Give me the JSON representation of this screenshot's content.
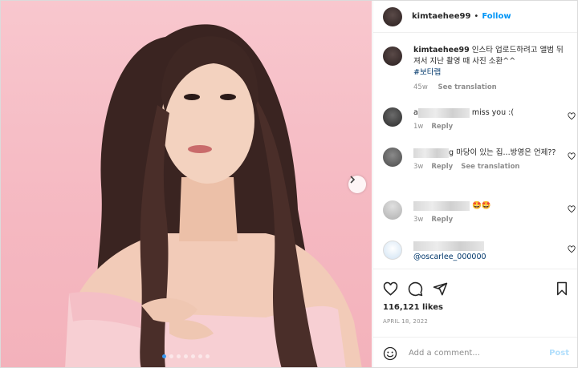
{
  "post": {
    "username": "kimtaehee99",
    "separator": "•",
    "follow_label": "Follow"
  },
  "caption": {
    "username": "kimtaehee99",
    "text": "인스타 업로드하려고 앨범 뒤져서 지난 촬영 때 사진 소환^^",
    "hashtag": "#보타랩",
    "time": "45w",
    "see_translation": "See translation"
  },
  "comments": [
    {
      "name_prefix": "a",
      "text": "miss you :(",
      "time": "1w",
      "reply": "Reply"
    },
    {
      "name_suffix": "g",
      "text": "마당이 있는 집...방영은 언제??",
      "time": "3w",
      "reply": "Reply",
      "see_translation": "See translation"
    },
    {
      "text": "🤩🤩",
      "time": "3w",
      "reply": "Reply"
    },
    {
      "text": "@oscarlee_000000"
    }
  ],
  "actions": {
    "likes": "116,121 likes",
    "date": "APRIL 18, 2022"
  },
  "add_comment": {
    "placeholder": "Add a comment...",
    "post_label": "Post"
  },
  "carousel": {
    "count": 7,
    "active": 0
  },
  "colors": {
    "accent": "#0095f6",
    "link": "#00376b",
    "muted": "#8e8e8e",
    "photo_bg": "#f5b8c1"
  },
  "icons": [
    "chevron-right-icon",
    "heart-icon",
    "comment-icon",
    "share-icon",
    "bookmark-icon",
    "emoji-icon"
  ]
}
